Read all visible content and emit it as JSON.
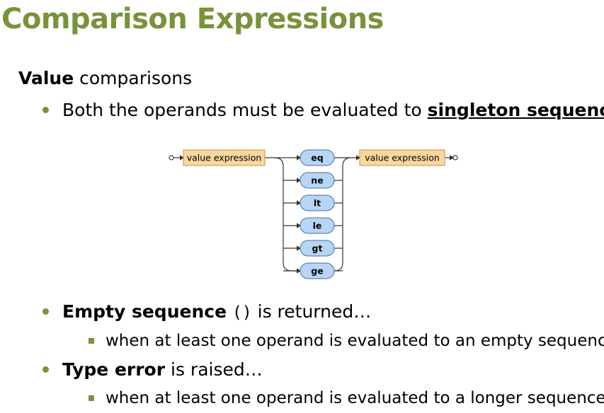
{
  "title": "Comparison Expressions",
  "section": {
    "bold": "Value",
    "rest": " comparisons"
  },
  "bullet1": {
    "text": "Both the operands must be evaluated to ",
    "emph": "singleton sequences"
  },
  "diagram": {
    "left_box": "value expression",
    "right_box": "value expression",
    "operators": [
      "eq",
      "ne",
      "lt",
      "le",
      "gt",
      "ge"
    ],
    "colors": {
      "box_fill": "#fad7a0",
      "box_stroke": "#c8903c",
      "op_fill": "#b7d6f5",
      "op_stroke": "#4a6f95"
    }
  },
  "bullet2": {
    "bold": "Empty sequence",
    "code": "()",
    "rest": " is returned…",
    "sub": "when at least one operand is evaluated to an empty sequence"
  },
  "bullet3": {
    "bold": "Type error",
    "rest": " is raised…",
    "sub": "when at least one operand is evaluated to a longer sequence"
  }
}
